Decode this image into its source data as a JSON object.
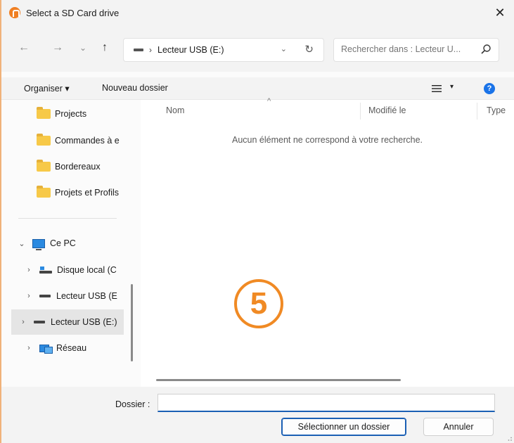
{
  "window": {
    "title": "Select a SD Card drive",
    "close_glyph": "✕"
  },
  "nav": {
    "back_glyph": "←",
    "forward_glyph": "→",
    "recent_glyph": "⌄",
    "up_glyph": "↑",
    "breadcrumb_sep": "›",
    "address": "Lecteur USB (E:)",
    "address_dropdown_glyph": "⌄",
    "refresh_glyph": "↻",
    "search_placeholder": "Rechercher dans : Lecteur U..."
  },
  "commands": {
    "organise": "Organiser ▾",
    "new_folder": "Nouveau dossier",
    "view_dropdown_glyph": "▾",
    "help_glyph": "?"
  },
  "sidebar": {
    "quick_access": [
      {
        "label": "Projects"
      },
      {
        "label": "Commandes à e"
      },
      {
        "label": "Bordereaux"
      },
      {
        "label": "Projets et Profils"
      }
    ],
    "this_pc": {
      "label": "Ce PC",
      "expander": "⌄"
    },
    "drives": [
      {
        "label": "Disque local (C",
        "expander": "›"
      },
      {
        "label": "Lecteur USB (E",
        "expander": "›"
      },
      {
        "label": "Lecteur USB (E:)",
        "expander": "›"
      }
    ],
    "network": {
      "label": "Réseau",
      "expander": "›"
    }
  },
  "content": {
    "columns": [
      "Nom",
      "Modifié le",
      "Type"
    ],
    "sort_caret": "^",
    "empty_message": "Aucun élément ne correspond à votre recherche.",
    "step_badge": "5"
  },
  "footer": {
    "folder_label": "Dossier :",
    "folder_value": "",
    "select_button": "Sélectionner un dossier",
    "cancel_button": "Annuler"
  },
  "colors": {
    "accent": "#1a5fb4",
    "badge": "#f08a24",
    "folder": "#f7c948"
  }
}
